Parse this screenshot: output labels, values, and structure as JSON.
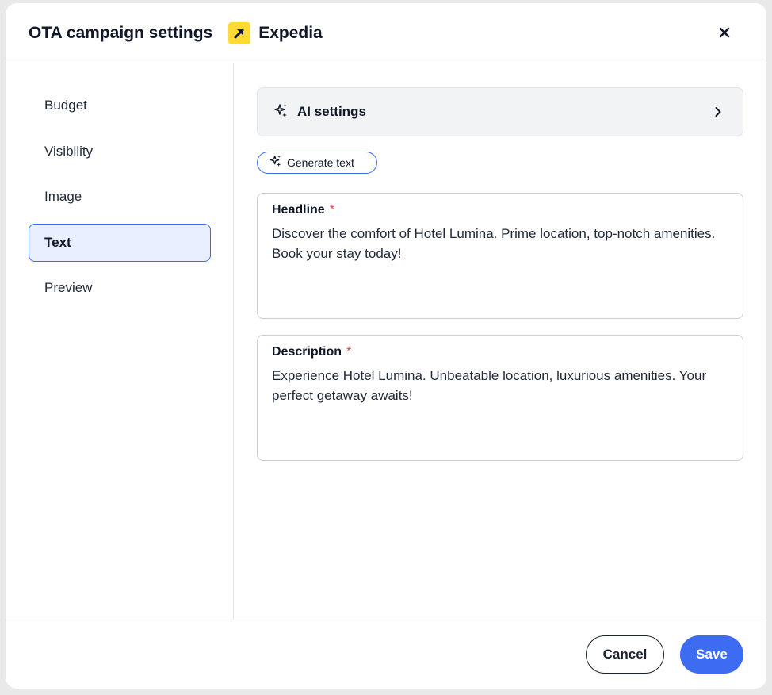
{
  "header": {
    "title": "OTA campaign settings",
    "brand_name": "Expedia",
    "brand_icon": "expedia-arrow-icon",
    "close_icon": "close-icon"
  },
  "sidebar": {
    "items": [
      {
        "label": "Budget",
        "active": false
      },
      {
        "label": "Visibility",
        "active": false
      },
      {
        "label": "Image",
        "active": false
      },
      {
        "label": "Text",
        "active": true
      },
      {
        "label": "Preview",
        "active": false
      }
    ]
  },
  "main": {
    "ai_settings": {
      "label": "AI settings",
      "icon": "sparkle-icon",
      "chevron": "chevron-right-icon"
    },
    "generate_button": {
      "label": "Generate text",
      "icon": "sparkle-icon"
    },
    "headline": {
      "label": "Headline",
      "required_mark": "*",
      "value": "Discover the comfort of Hotel Lumina. Prime location, top-notch amenities. Book your stay today!"
    },
    "description": {
      "label": "Description",
      "required_mark": "*",
      "value": "Experience Hotel Lumina. Unbeatable location, luxurious amenities. Your perfect getaway awaits!"
    }
  },
  "footer": {
    "cancel_label": "Cancel",
    "save_label": "Save"
  },
  "colors": {
    "accent": "#3d6bf2",
    "brand_yellow": "#fddb32",
    "required": "#e5484d",
    "active_bg": "#e9efff"
  }
}
